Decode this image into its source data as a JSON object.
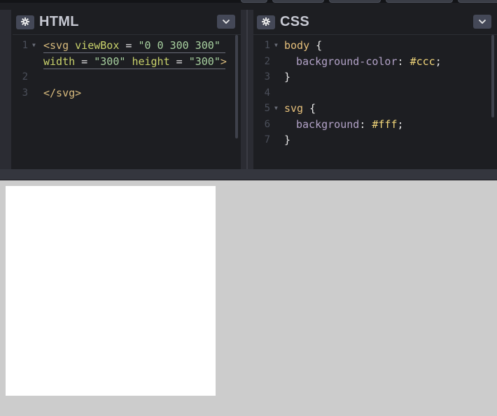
{
  "editors": {
    "html": {
      "title": "HTML",
      "line_numbers": [
        "1",
        "2",
        "3"
      ],
      "code": {
        "l1_tag_open": "<svg",
        "l1_attr1": "viewBox",
        "l1_eq": " = ",
        "l1_val1": "\"0 0 300 300\"",
        "l1b_attr2": "width",
        "l1b_eq": " = ",
        "l1b_val2": "\"300\"",
        "l1b_attr3": "height",
        "l1b_eq2": " = ",
        "l1b_val3": "\"300\"",
        "l1b_close": ">",
        "l3_tag_close": "</svg>"
      }
    },
    "css": {
      "title": "CSS",
      "line_numbers": [
        "1",
        "2",
        "3",
        "4",
        "5",
        "6",
        "7"
      ],
      "code": {
        "l1_selector": "body",
        "l1_brace": " {",
        "l2_prop": "background-color",
        "l2_colon": ": ",
        "l2_val": "#ccc",
        "l2_semi": ";",
        "l3_brace": "}",
        "l5_selector": "svg",
        "l5_brace": " {",
        "l6_prop": "background",
        "l6_colon": ": ",
        "l6_val": "#fff",
        "l6_semi": ";",
        "l7_brace": "}"
      }
    }
  },
  "icons": {
    "settings": "gear-icon",
    "collapse": "chevron-down-icon"
  },
  "colors": {
    "editor_bg": "#1d1e22",
    "preview_bg": "#cccccc",
    "svg_bg": "#ffffff"
  }
}
